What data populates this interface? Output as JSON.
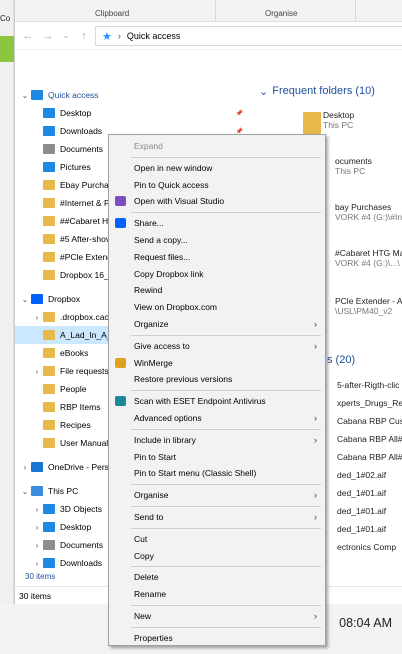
{
  "background": {
    "left_text": "Co",
    "clock": "08:04 AM"
  },
  "ribbon": {
    "groups": [
      "Clipboard",
      "Organise"
    ]
  },
  "address": {
    "path": "Quick access"
  },
  "tree": [
    {
      "label": "Quick access",
      "level": 0,
      "icon": "star-icon",
      "expand": "v",
      "selected": false,
      "section": true
    },
    {
      "label": "Desktop",
      "level": 1,
      "icon": "desktop-icon",
      "pin": true
    },
    {
      "label": "Downloads",
      "level": 1,
      "icon": "downloads-icon",
      "pin": true
    },
    {
      "label": "Documents",
      "level": 1,
      "icon": "documents-icon",
      "pin": true
    },
    {
      "label": "Pictures",
      "level": 1,
      "icon": "pictures-icon"
    },
    {
      "label": "Ebay Purchas",
      "level": 1,
      "icon": "folder-icon"
    },
    {
      "label": "#Internet & P",
      "level": 1,
      "icon": "folder-icon"
    },
    {
      "label": "##Cabaret HT",
      "level": 1,
      "icon": "folder-icon"
    },
    {
      "label": "#5 After-shov",
      "level": 1,
      "icon": "folder-icon"
    },
    {
      "label": "#PCle Extend",
      "level": 1,
      "icon": "folder-icon"
    },
    {
      "label": "Dropbox 16_0",
      "level": 1,
      "icon": "folder-icon"
    },
    {
      "label": "Dropbox",
      "level": 0,
      "icon": "dropbox-icon",
      "expand": "v"
    },
    {
      "label": ".dropbox.cacl",
      "level": 1,
      "icon": "folder-icon",
      "expand": ">"
    },
    {
      "label": "A_Lad_In_A_C",
      "level": 1,
      "icon": "folder-synced-icon",
      "selected": true
    },
    {
      "label": "eBooks",
      "level": 1,
      "icon": "folder-synced-icon"
    },
    {
      "label": "File requests",
      "level": 1,
      "icon": "folder-synced-icon",
      "expand": ">"
    },
    {
      "label": "People",
      "level": 1,
      "icon": "folder-synced-icon"
    },
    {
      "label": "RBP Items",
      "level": 1,
      "icon": "folder-synced-icon"
    },
    {
      "label": "Recipes",
      "level": 1,
      "icon": "folder-synced-icon"
    },
    {
      "label": "User Manuals",
      "level": 1,
      "icon": "folder-synced-icon"
    },
    {
      "label": "OneDrive - Pers",
      "level": 0,
      "icon": "onedrive-icon",
      "expand": ">"
    },
    {
      "label": "This PC",
      "level": 0,
      "icon": "pc-icon",
      "expand": "v"
    },
    {
      "label": "3D Objects",
      "level": 1,
      "icon": "objects-3d-icon",
      "expand": ">"
    },
    {
      "label": "Desktop",
      "level": 1,
      "icon": "desktop-icon",
      "expand": ">"
    },
    {
      "label": "Documents",
      "level": 1,
      "icon": "documents-icon",
      "expand": ">"
    },
    {
      "label": "Downloads",
      "level": 1,
      "icon": "downloads-icon",
      "expand": ">"
    }
  ],
  "tree_footer": "30 items",
  "status": {
    "text": "30 items"
  },
  "right": {
    "frequent_title": "Frequent folders (10)",
    "recent_title": "s (20)",
    "frequent": [
      {
        "line1": "Desktop",
        "line2": "This PC"
      },
      {
        "line1": "ocuments",
        "line2": "This PC"
      },
      {
        "line1": "bay Purchases",
        "line2": "VORK #4 (G:)\\#Int"
      },
      {
        "line1": "#Cabaret HTG Ma",
        "line2": "VORK #4 (G:)\\...\\"
      },
      {
        "line1": "PCle Extender - A",
        "line2": "\\USL\\PM40_v2"
      }
    ],
    "recent": [
      "5-after-Rigth-clic",
      "xperts_Drugs_Renew",
      "Cabana RBP Cust",
      "Cabana RBP All#",
      "Cabana RBP All#",
      "ded_1#02.aif",
      "ded_1#01.aif",
      "ded_1#01.aif",
      "ded_1#01.aif",
      "ectronics Comp"
    ]
  },
  "context_menu": {
    "items": [
      {
        "label": "Expand",
        "disabled": true
      },
      {
        "sep": true
      },
      {
        "label": "Open in new window"
      },
      {
        "label": "Pin to Quick access"
      },
      {
        "label": "Open with Visual Studio",
        "icon": "visual-studio-icon",
        "icon_color": "#7b4fbf"
      },
      {
        "sep": true
      },
      {
        "label": "Share...",
        "icon": "dropbox-icon",
        "icon_color": "#0061fe"
      },
      {
        "label": "Send a copy..."
      },
      {
        "label": "Request files..."
      },
      {
        "label": "Copy Dropbox link"
      },
      {
        "label": "Rewind"
      },
      {
        "label": "View on Dropbox.com"
      },
      {
        "label": "Organize",
        "submenu": true
      },
      {
        "sep": true
      },
      {
        "label": "Give access to",
        "submenu": true
      },
      {
        "label": "WinMerge",
        "icon": "winmerge-icon",
        "icon_color": "#e0a020"
      },
      {
        "label": "Restore previous versions"
      },
      {
        "sep": true
      },
      {
        "label": "Scan with ESET Endpoint Antivirus",
        "icon": "eset-icon",
        "icon_color": "#1a8a9a"
      },
      {
        "label": "Advanced options",
        "submenu": true
      },
      {
        "sep": true
      },
      {
        "label": "Include in library",
        "submenu": true
      },
      {
        "label": "Pin to Start"
      },
      {
        "label": "Pin to Start menu (Classic Shell)"
      },
      {
        "sep": true
      },
      {
        "label": "Organise",
        "submenu": true
      },
      {
        "sep": true
      },
      {
        "label": "Send to",
        "submenu": true
      },
      {
        "sep": true
      },
      {
        "label": "Cut"
      },
      {
        "label": "Copy"
      },
      {
        "sep": true
      },
      {
        "label": "Delete"
      },
      {
        "label": "Rename"
      },
      {
        "sep": true
      },
      {
        "label": "New",
        "submenu": true
      },
      {
        "sep": true
      },
      {
        "label": "Properties"
      }
    ]
  }
}
